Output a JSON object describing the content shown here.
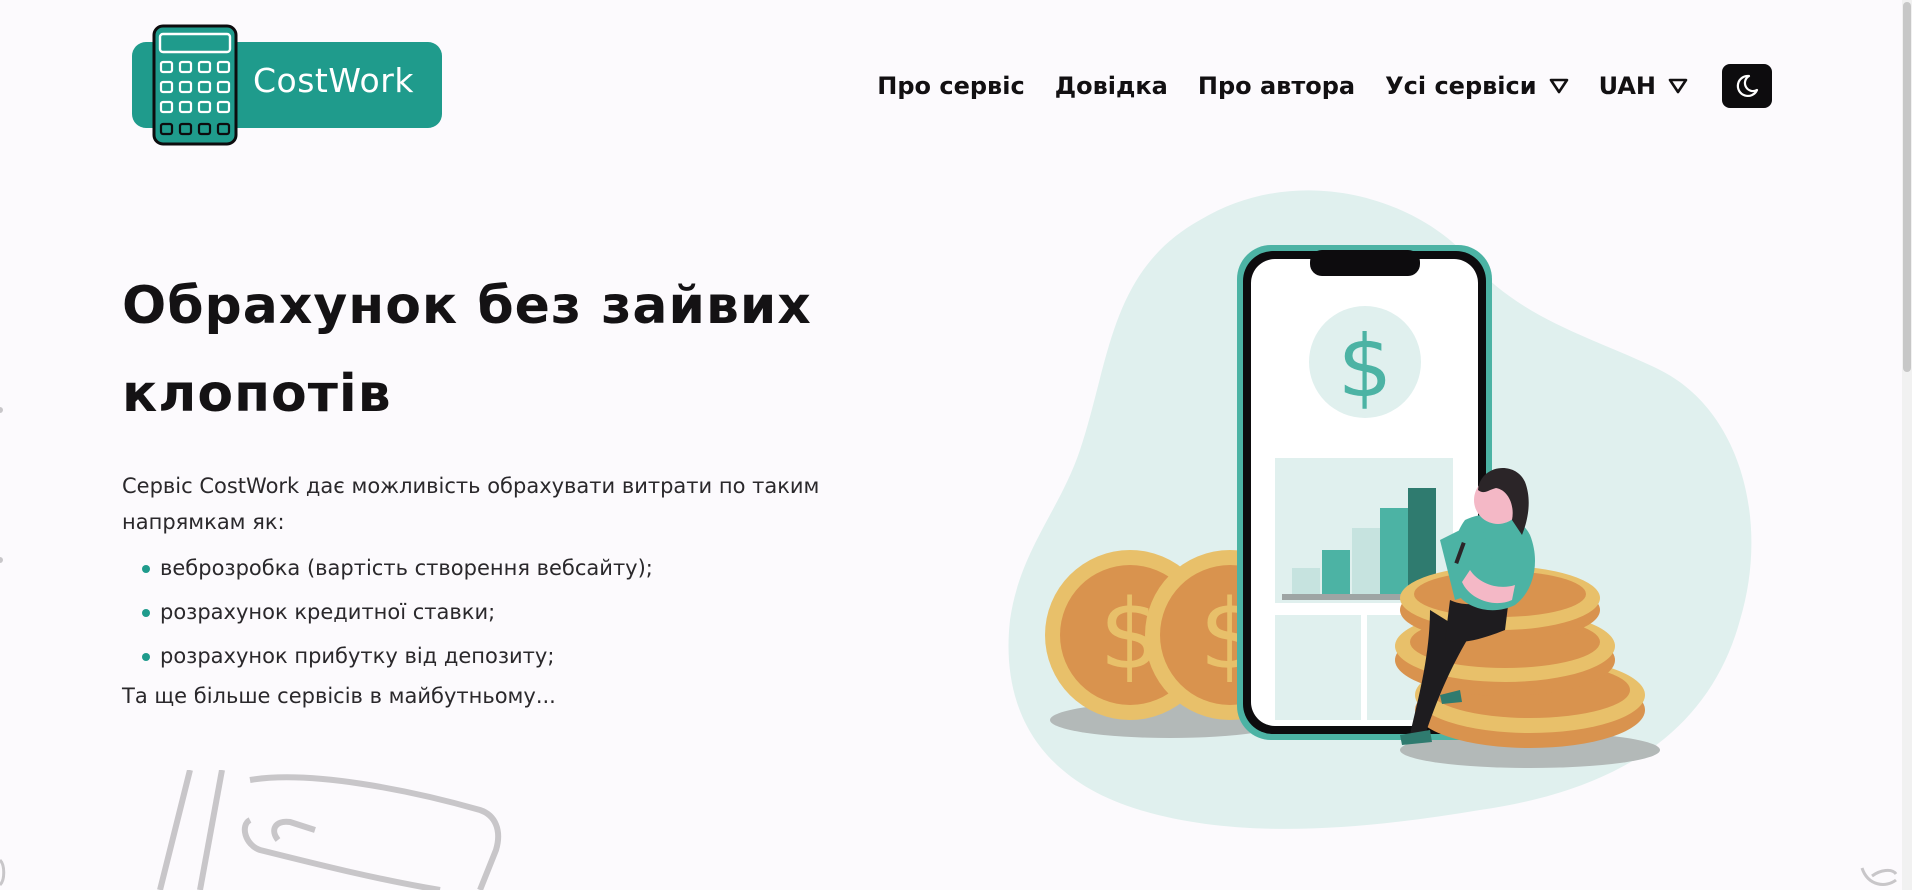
{
  "header": {
    "logo_text": "CostWork",
    "nav": [
      {
        "label": "Про сервіс"
      },
      {
        "label": "Довідка"
      },
      {
        "label": "Про автора"
      },
      {
        "label": "Усі сервіси",
        "has_dropdown": true
      },
      {
        "label": "UAH",
        "has_dropdown": true
      }
    ],
    "theme_toggle_icon": "moon-icon"
  },
  "hero": {
    "title": "Обрахунок без зайвих клопотів",
    "description": "Сервіс CostWork дає можливість обрахувати витрати по таким напрямкам як:",
    "list": [
      "веброзробка (вартість створення вебсайту);",
      "розрахунок кредитної ставки;",
      "розрахунок прибутку від депозиту;"
    ],
    "footer_text": "Та ще більше сервісів в майбутньому...",
    "illustration_symbol": "$"
  },
  "colors": {
    "brand": "#1f9b8c",
    "accent_light": "#e0f0ee",
    "coin": "#e3a955",
    "text": "#141214",
    "dark": "#0d0c0e"
  }
}
